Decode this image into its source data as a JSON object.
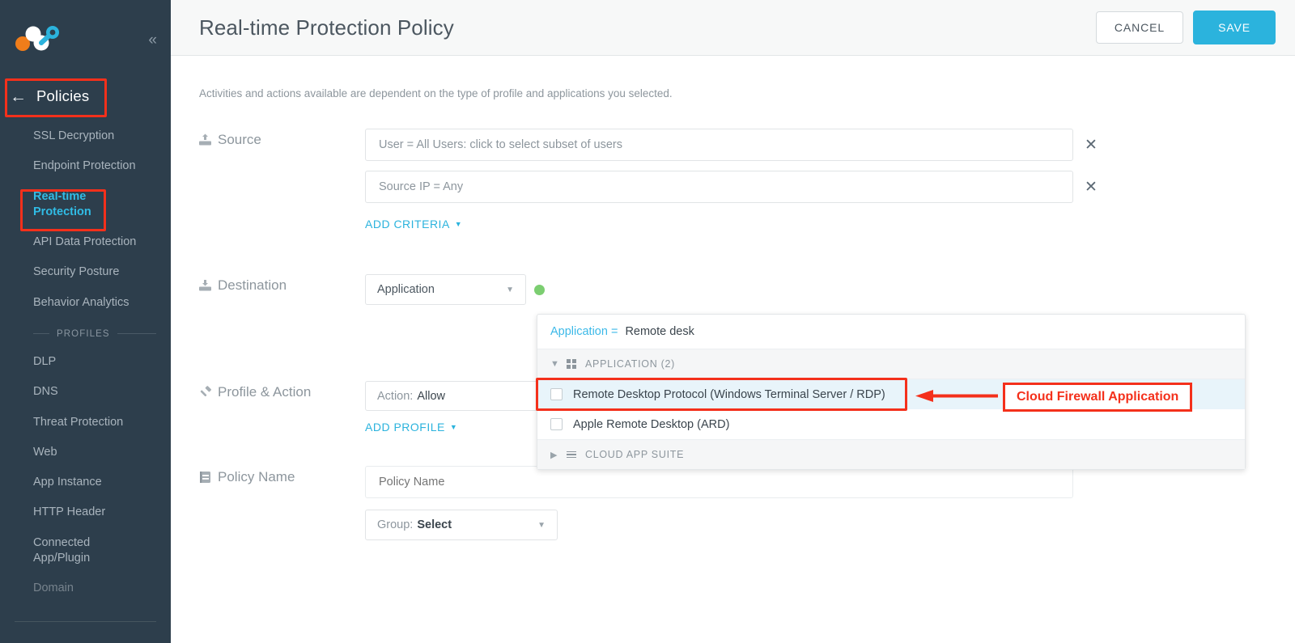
{
  "sidebar": {
    "logo_name": "netskope-logo",
    "collapse_icon": "chevron-double-left-icon",
    "back_icon": "arrow-left-icon",
    "policies_label": "Policies",
    "nav_items": [
      {
        "label": "SSL Decryption",
        "active": false
      },
      {
        "label": "Endpoint Protection",
        "active": false
      },
      {
        "label": "Real-time\nProtection",
        "active": true
      },
      {
        "label": "API Data Protection",
        "active": false
      },
      {
        "label": "Security Posture",
        "active": false
      },
      {
        "label": "Behavior Analytics",
        "active": false
      }
    ],
    "profiles_section_label": "PROFILES",
    "profile_items": [
      {
        "label": "DLP"
      },
      {
        "label": "DNS"
      },
      {
        "label": "Threat Protection"
      },
      {
        "label": "Web"
      },
      {
        "label": "App Instance"
      },
      {
        "label": "HTTP Header"
      },
      {
        "label": "Connected\nApp/Plugin"
      },
      {
        "label": "Domain"
      }
    ]
  },
  "header": {
    "title": "Real-time Protection Policy",
    "cancel_label": "CANCEL",
    "save_label": "SAVE"
  },
  "main": {
    "helper_text": "Activities and actions available are dependent on the type of profile and applications you selected.",
    "source": {
      "icon": "upload-arrow-icon",
      "label": "Source",
      "criteria": [
        {
          "text": "User = All Users: click to select subset of users",
          "remove_icon": "close-icon"
        },
        {
          "text": "Source IP = Any",
          "remove_icon": "close-icon"
        }
      ],
      "add_link": "ADD CRITERIA"
    },
    "destination": {
      "icon": "download-arrow-icon",
      "label": "Destination",
      "type_select_value": "Application",
      "status_dot_color": "#7cce71",
      "dropdown": {
        "search_key": "Application =",
        "search_value": "Remote desk",
        "groups": [
          {
            "name": "APPLICATION (2)",
            "icon": "grid-icon",
            "expanded": true,
            "chevron": "chevron-down-icon",
            "items": [
              {
                "label": "Remote Desktop Protocol (Windows Terminal Server / RDP)",
                "checked": false,
                "selected": true
              },
              {
                "label": "Apple Remote Desktop (ARD)",
                "checked": false,
                "selected": false
              }
            ]
          },
          {
            "name": "CLOUD APP SUITE",
            "icon": "lines-icon",
            "expanded": false,
            "chevron": "chevron-right-icon",
            "items": []
          }
        ]
      }
    },
    "profile_action": {
      "icon": "gavel-icon",
      "label": "Profile & Action",
      "action_prefix": "Action:",
      "action_value": "Allow",
      "add_link": "ADD PROFILE"
    },
    "policy_name": {
      "icon": "list-document-icon",
      "label": "Policy Name",
      "input_placeholder": "Policy Name",
      "group_prefix": "Group:",
      "group_value": "Select"
    }
  },
  "annotations": {
    "callout_text": "Cloud Firewall Application",
    "callout_color": "#f4301b",
    "highlight_boxes": [
      "policies",
      "real-time-protection",
      "rdp-row"
    ],
    "arrow_icon": "arrow-left-icon"
  }
}
